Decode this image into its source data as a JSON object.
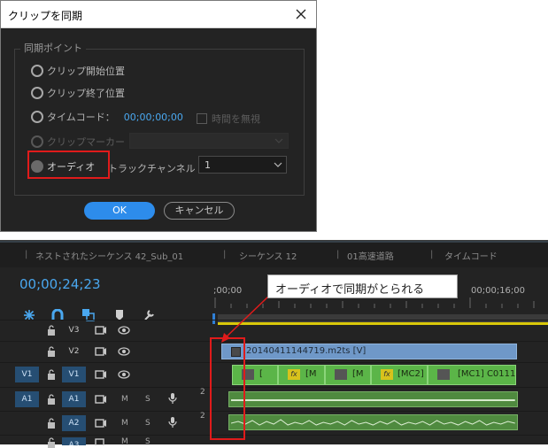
{
  "dialog": {
    "title": "クリップを同期",
    "group_label": "同期ポイント",
    "options": [
      {
        "label": "クリップ開始位置",
        "enabled": true
      },
      {
        "label": "クリップ終了位置",
        "enabled": true
      },
      {
        "label": "タイムコード：",
        "enabled": true
      },
      {
        "label": "クリップマーカー",
        "enabled": false
      },
      {
        "label": "オーディオ",
        "enabled": true,
        "selected": true
      }
    ],
    "timecode_value": "00;00;00;00",
    "ignore_time_label": "時間を無視",
    "track_channel_label": "トラックチャンネル",
    "track_channel_value": "1",
    "ok_label": "OK",
    "cancel_label": "キャンセル",
    "colors": {
      "accent": "#2d8ceb",
      "highlight": "#e01b1b"
    }
  },
  "timeline": {
    "tabs": [
      "ネストされたシーケンス 42_Sub_01",
      "シーケンス 12",
      "01高速道路",
      "タイムコード"
    ],
    "timecode": "00;00;24;23",
    "ruler": {
      "start": ";00;00",
      "mark16": "00;00;16;00"
    },
    "callout": "オーディオで同期がとられる",
    "tracks": [
      {
        "name": "V3",
        "src": ""
      },
      {
        "name": "V2",
        "src": ""
      },
      {
        "name": "V1",
        "src": "V1",
        "active": true
      },
      {
        "name": "A1",
        "src": "A1",
        "active": true,
        "m": "M",
        "s": "S",
        "ch": "2"
      },
      {
        "name": "A2",
        "src": "",
        "active": true,
        "m": "M",
        "s": "S",
        "ch": "2"
      },
      {
        "name": "A3",
        "src": "",
        "active": true,
        "m": "M",
        "s": "S"
      }
    ],
    "clips": {
      "v2": "20140411144719.m2ts [V]",
      "v1": [
        "[",
        "[M",
        "[M",
        "[MC2]",
        "[MC1] C0111"
      ]
    }
  }
}
